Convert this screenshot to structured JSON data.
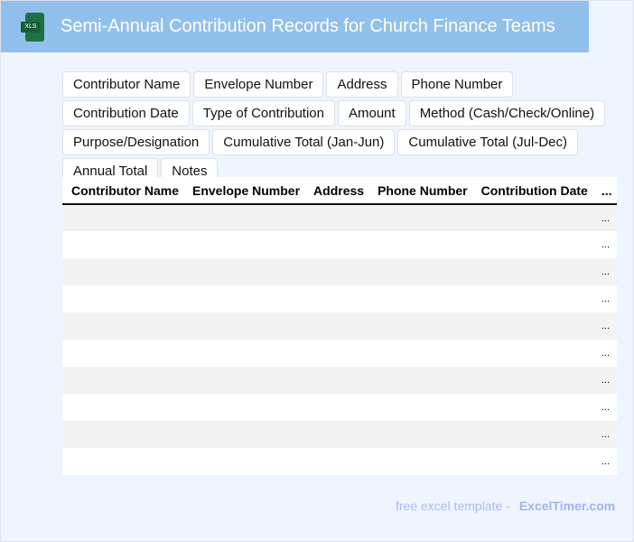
{
  "header": {
    "title": "Semi-Annual Contribution Records for Church Finance Teams",
    "icon": "xls-file-icon",
    "icon_label": "XLS"
  },
  "fields": [
    "Contributor Name",
    "Envelope Number",
    "Address",
    "Phone Number",
    "Contribution Date",
    "Type of Contribution",
    "Amount",
    "Method (Cash/Check/Online)",
    "Purpose/Designation",
    "Cumulative Total (Jan-Jun)",
    "Cumulative Total (Jul-Dec)",
    "Annual Total",
    "Notes"
  ],
  "table": {
    "columns": [
      "Contributor Name",
      "Envelope Number",
      "Address",
      "Phone Number",
      "Contribution Date",
      "..."
    ],
    "rows": [
      "...",
      "...",
      "...",
      "...",
      "...",
      "...",
      "...",
      "...",
      "...",
      "..."
    ]
  },
  "footer": {
    "text": "free excel template -",
    "brand": "ExcelTimer.com"
  }
}
